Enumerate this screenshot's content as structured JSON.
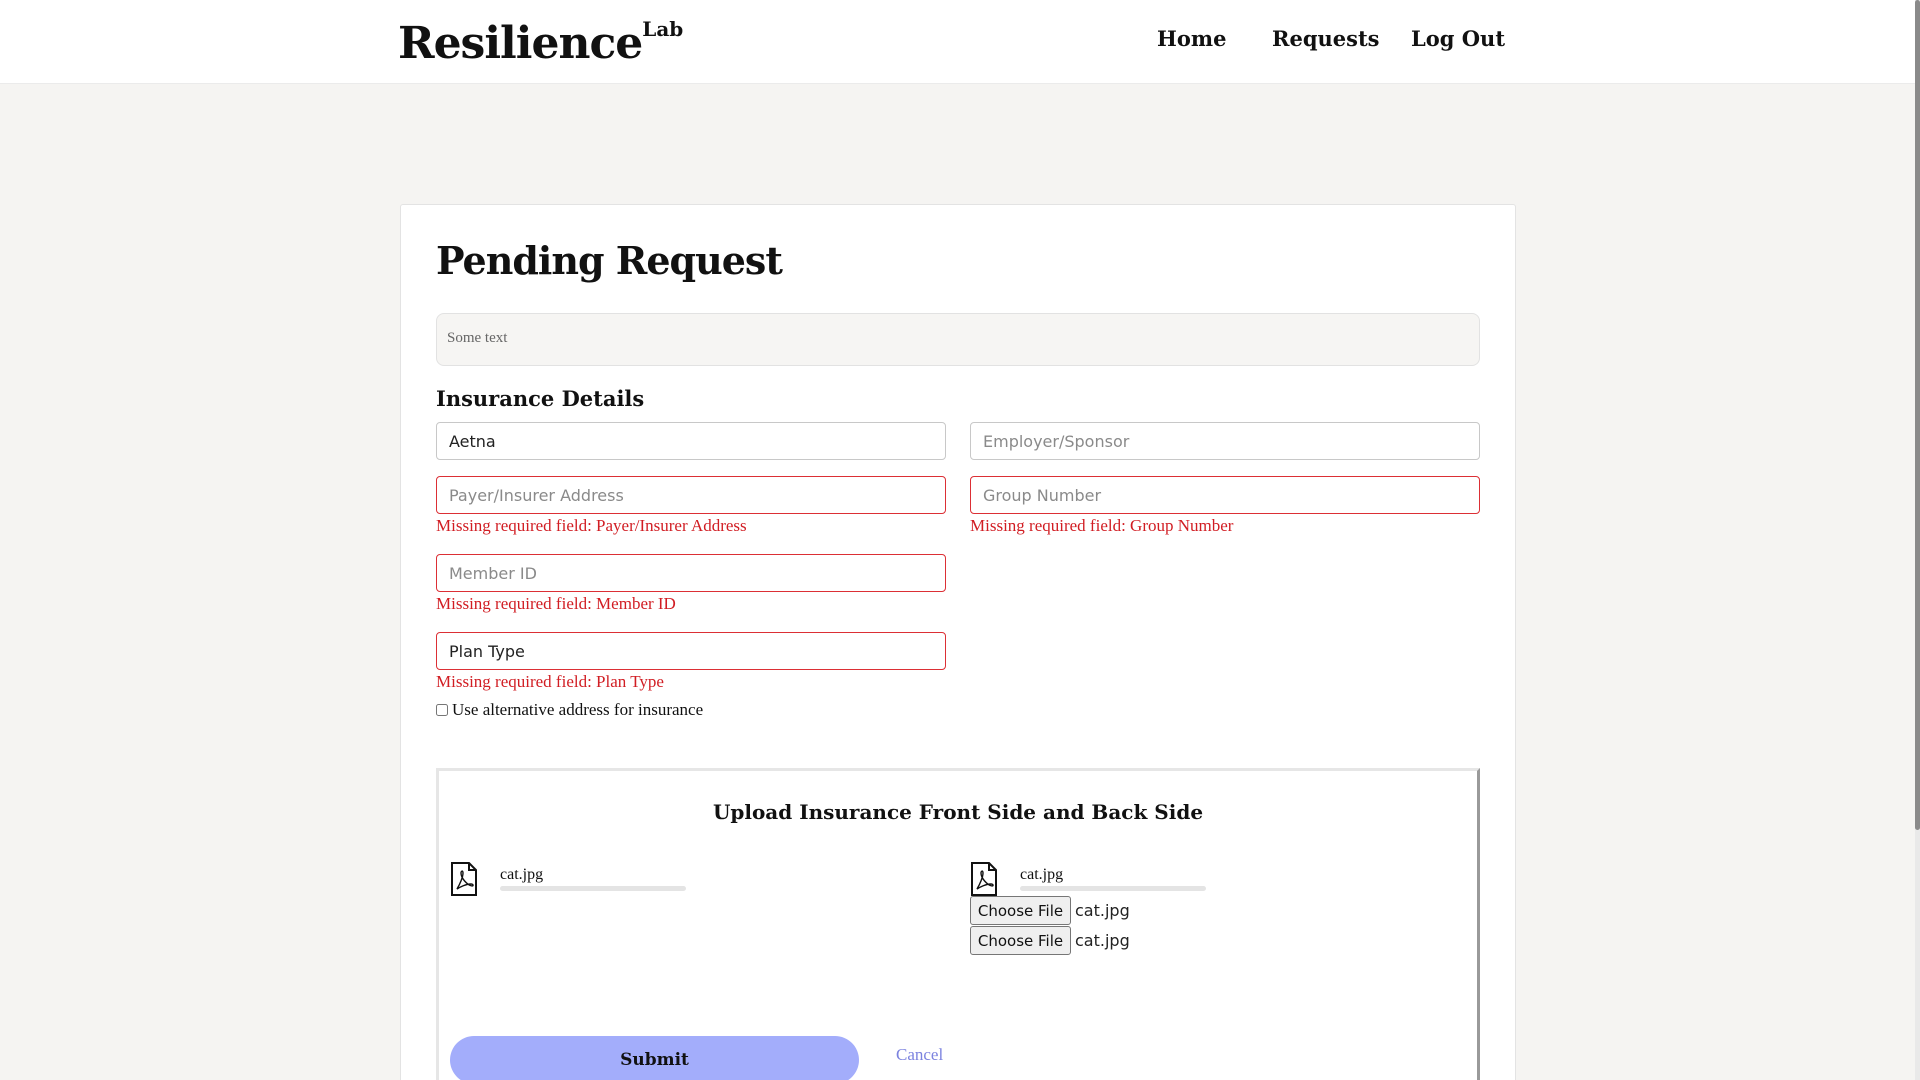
{
  "header": {
    "logo_text": "Resilience",
    "logo_sup": "Lab",
    "nav": [
      "Home",
      "Requests",
      "Log Out"
    ]
  },
  "card": {
    "title": "Pending Request",
    "info_text": "Some text",
    "section_title": "Insurance Details"
  },
  "fields": {
    "payer": {
      "value": "Aetna",
      "placeholder": ""
    },
    "employer": {
      "value": "",
      "placeholder": "Employer/Sponsor"
    },
    "payer_address": {
      "value": "",
      "placeholder": "Payer/Insurer Address",
      "error": "Missing required field: Payer/Insurer Address"
    },
    "group_number": {
      "value": "",
      "placeholder": "Group Number",
      "error": "Missing required field: Group Number"
    },
    "member_id": {
      "value": "",
      "placeholder": "Member ID",
      "error": "Missing required field: Member ID"
    },
    "plan_type": {
      "value": "Plan Type",
      "placeholder": "",
      "error": "Missing required field: Plan Type"
    }
  },
  "checkbox": {
    "label": "Use alternative address for insurance",
    "checked": false
  },
  "upload": {
    "title": "Upload Insurance Front Side and Back Side",
    "front_file": "cat.jpg",
    "back_file": "cat.jpg",
    "front_progress": 0,
    "back_progress": 0,
    "choose_button": "Choose File",
    "chosen_files": [
      "cat.jpg",
      "cat.jpg"
    ]
  },
  "actions": {
    "submit": "Submit",
    "cancel": "Cancel"
  },
  "colors": {
    "error": "#d11d23",
    "accent": "#a3adfb",
    "link": "#7c83df"
  }
}
